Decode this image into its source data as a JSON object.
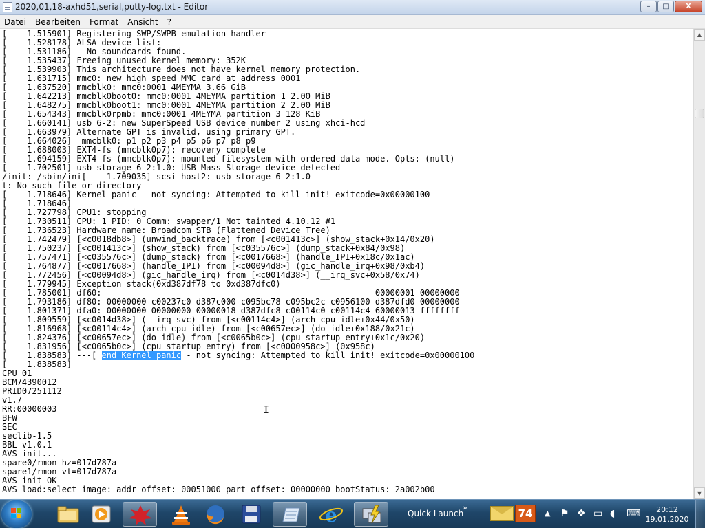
{
  "window": {
    "title": "2020,01,18-axhd51,serial,putty-log.txt - Editor",
    "buttons": {
      "minimize": "–",
      "maximize": "□",
      "close": "X"
    }
  },
  "menu": [
    "Datei",
    "Bearbeiten",
    "Format",
    "Ansicht",
    "?"
  ],
  "editor": {
    "lines": [
      "[    1.515901] Registering SWP/SWPB emulation handler",
      "[    1.528178] ALSA device list:",
      "[    1.531186]   No soundcards found.",
      "[    1.535437] Freeing unused kernel memory: 352K",
      "[    1.539903] This architecture does not have kernel memory protection.",
      "[    1.631715] mmc0: new high speed MMC card at address 0001",
      "[    1.637520] mmcblk0: mmc0:0001 4MEYMA 3.66 GiB",
      "[    1.642213] mmcblk0boot0: mmc0:0001 4MEYMA partition 1 2.00 MiB",
      "[    1.648275] mmcblk0boot1: mmc0:0001 4MEYMA partition 2 2.00 MiB",
      "[    1.654343] mmcblk0rpmb: mmc0:0001 4MEYMA partition 3 128 KiB",
      "[    1.660141] usb 6-2: new SuperSpeed USB device number 2 using xhci-hcd",
      "[    1.663979] Alternate GPT is invalid, using primary GPT.",
      "[    1.664026]  mmcblk0: p1 p2 p3 p4 p5 p6 p7 p8 p9",
      "[    1.688003] EXT4-fs (mmcblk0p7): recovery complete",
      "[    1.694159] EXT4-fs (mmcblk0p7): mounted filesystem with ordered data mode. Opts: (null)",
      "[    1.702501] usb-storage 6-2:1.0: USB Mass Storage device detected",
      "/init: /sbin/ini[    1.709035] scsi host2: usb-storage 6-2:1.0",
      "t: No such file or directory",
      "[    1.718646] Kernel panic - not syncing: Attempted to kill init! exitcode=0x00000100",
      "[    1.718646]",
      "[    1.727798] CPU1: stopping",
      "[    1.730511] CPU: 1 PID: 0 Comm: swapper/1 Not tainted 4.10.12 #1",
      "[    1.736523] Hardware name: Broadcom STB (Flattened Device Tree)",
      "[    1.742479] [<c0018db8>] (unwind_backtrace) from [<c001413c>] (show_stack+0x14/0x20)",
      "[    1.750237] [<c001413c>] (show_stack) from [<c035576c>] (dump_stack+0x84/0x98)",
      "[    1.757471] [<c035576c>] (dump_stack) from [<c0017668>] (handle_IPI+0x18c/0x1ac)",
      "[    1.764877] [<c0017668>] (handle_IPI) from [<c00094d8>] (gic_handle_irq+0x98/0xb4)",
      "[    1.772456] [<c00094d8>] (gic_handle_irq) from [<c0014d38>] (__irq_svc+0x58/0x74)",
      "[    1.779945] Exception stack(0xd387df78 to 0xd387dfc0)",
      "[    1.785001] df60:                                                       00000001 00000000",
      "[    1.793186] df80: 00000000 c00237c0 d387c000 c095bc78 c095bc2c c0956100 d387dfd0 00000000",
      "[    1.801371] dfa0: 00000000 00000000 00000018 d387dfc8 c00114c0 c00114c4 60000013 ffffffff",
      "[    1.809559] [<c0014d38>] (__irq_svc) from [<c00114c4>] (arch_cpu_idle+0x44/0x50)",
      "[    1.816968] [<c00114c4>] (arch_cpu_idle) from [<c00657ec>] (do_idle+0x188/0x21c)",
      "[    1.824376] [<c00657ec>] (do_idle) from [<c0065b0c>] (cpu_startup_entry+0x1c/0x20)",
      "[    1.831956] [<c0065b0c>] (cpu_startup_entry) from [<c0000958c>] (0x958c)",
      {
        "pre": "[    1.838583] ---[ ",
        "sel": "end Kernel panic",
        "post": " - not syncing: Attempted to kill init! exitcode=0x00000100"
      },
      "[    1.838583]",
      "CPU 01",
      "BCM74390012",
      "PRID07251112",
      "v1.7",
      "RR:00000003",
      "BFW",
      "SEC",
      "seclib-1.5",
      "BBL v1.0.1",
      "AVS init...",
      "spare0/rmon_hz=017d787a",
      "spare1/rmon_vt=017d787a",
      "AVS init OK",
      "AVS load:select_image: addr_offset: 00051000 part_offset: 00000000 bootStatus: 2a002b00"
    ]
  },
  "taskbar": {
    "quick_launch": "Quick Launch",
    "badge_count": "74",
    "clock_time": "20:12",
    "clock_date": "19.01.2020"
  }
}
